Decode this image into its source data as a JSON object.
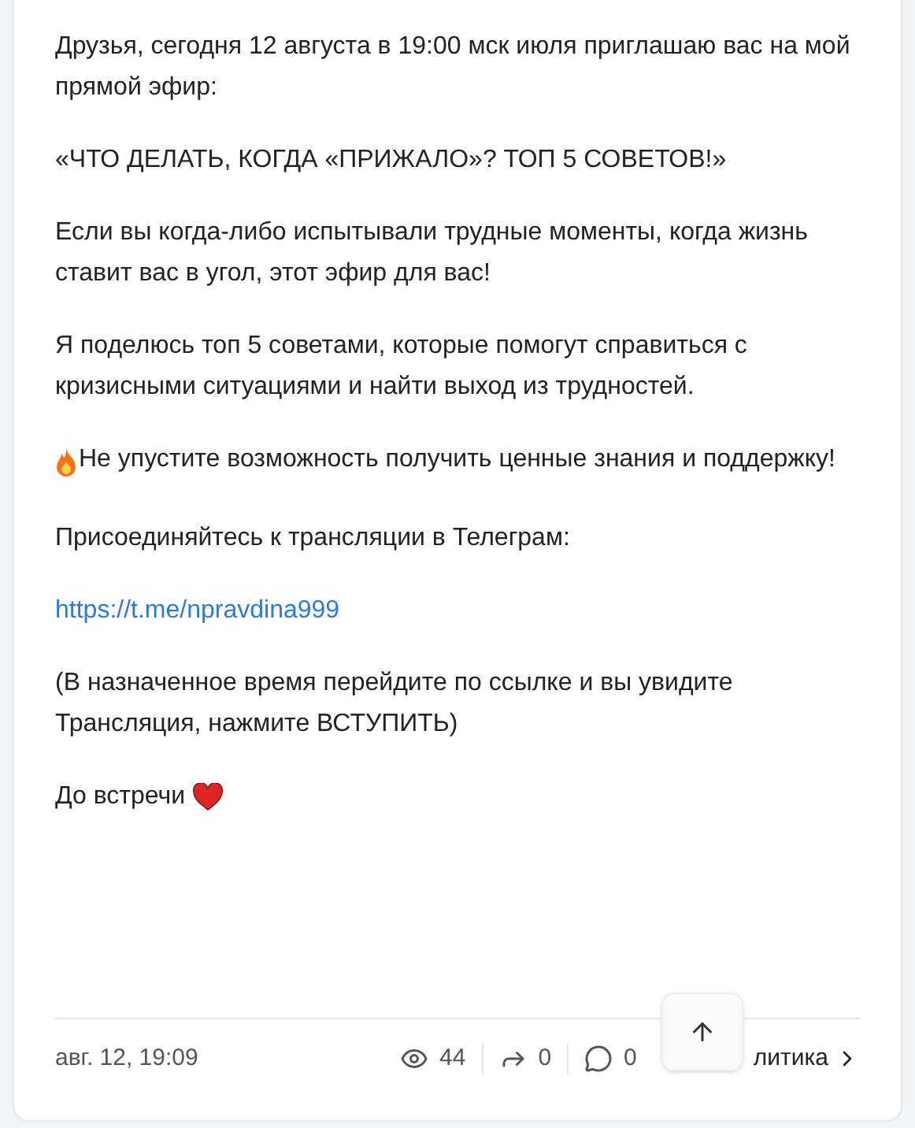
{
  "post": {
    "paragraphs": [
      {
        "kind": "text",
        "text": "Друзья, сегодня 12 августа в 19:00 мск июля приглашаю вас на мой прямой эфир:"
      },
      {
        "kind": "text",
        "text": "«ЧТО ДЕЛАТЬ, КОГДА «ПРИЖАЛО»? ТОП 5 СОВЕТОВ!»"
      },
      {
        "kind": "text",
        "text": "Если вы когда-либо испытывали трудные моменты, когда жизнь ставит вас в угол, этот эфир для вас!"
      },
      {
        "kind": "text",
        "text": "Я поделюсь топ 5 советами, которые помогут справиться с кризисными ситуациями и найти выход из трудностей."
      },
      {
        "kind": "fire",
        "text": "Не упустите возможность получить ценные знания и поддержку!"
      },
      {
        "kind": "text",
        "text": "Присоединяйтесь к трансляции в Телеграм:"
      },
      {
        "kind": "link",
        "text": "https://t.me/npravdina999"
      },
      {
        "kind": "text",
        "text": "(В назначенное время перейдите по ссылке и вы увидите Трансляция, нажмите ВСТУПИТЬ)"
      },
      {
        "kind": "heart",
        "text": "До встречи"
      }
    ]
  },
  "footer": {
    "date": "авг. 12, 19:09",
    "views": "44",
    "shares": "0",
    "comments": "0",
    "analytics": "литика"
  }
}
